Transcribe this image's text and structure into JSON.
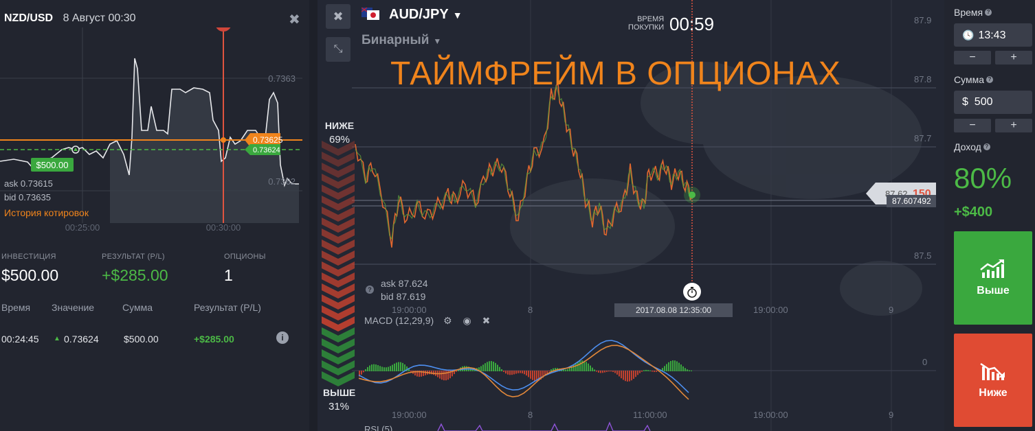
{
  "left_panel": {
    "pair": "NZD/USD",
    "date": "8 Август 00:30",
    "close_icon": "✖",
    "chart": {
      "price_levels": [
        "0.7363",
        "0.7362"
      ],
      "strike_label": "$500.00",
      "orange_tag": "0.73625",
      "green_tag": "0.73624",
      "ask": "ask 0.73615",
      "bid": "bid 0.73635",
      "history_link": "История котировок",
      "time_labels": [
        "00:25:00",
        "00:30:00"
      ]
    },
    "stats": [
      {
        "label": "ИНВЕСТИЦИЯ",
        "value": "$500.00",
        "color": "#ffffff"
      },
      {
        "label": "РЕЗУЛЬТАТ (P/L)",
        "value": "+$285.00",
        "color": "#4cba46"
      },
      {
        "label": "ОПЦИОНЫ",
        "value": "1",
        "color": "#ffffff"
      }
    ],
    "table": {
      "headers": [
        "Время",
        "Значение",
        "Сумма",
        "Результат (P/L)"
      ],
      "rows": [
        {
          "time": "00:24:45",
          "value": "0.73624",
          "amount": "$500.00",
          "result": "+$285.00"
        }
      ]
    }
  },
  "main_chart": {
    "asset": "AUD/JPY",
    "type": "Бинарный",
    "purchase_label_1": "ВРЕМЯ",
    "purchase_label_2": "ПОКУПКИ",
    "purchase_timer": "00:59",
    "overlay_title": "ТАЙМФРЕЙМ В ОПЦИОНАХ",
    "lower_label": "НИЖЕ",
    "lower_pct": "69%",
    "upper_label": "ВЫШЕ",
    "upper_pct": "31%",
    "ask": "ask 87.624",
    "bid": "bid 87.619",
    "price_levels": [
      "87.9",
      "87.8",
      "87.7",
      "87.5"
    ],
    "current_price": "87.62",
    "current_price_suffix": "150",
    "strike_price": "87.607492",
    "macd_label": "MACD (12,29,9)",
    "macd_zero": "0",
    "rsi_label": "RSI (5)",
    "expiry_datetime": "2017.08.08 12:35:00",
    "time_axis": [
      "19:00:00",
      "8",
      "19:00:00",
      "9"
    ],
    "time_axis_lower": [
      "19:00:00",
      "8",
      "11:00:00",
      "19:00:00",
      "9"
    ]
  },
  "right_panel": {
    "time_label": "Время",
    "time_value": "13:43",
    "amount_label": "Сумма",
    "amount_value": "$  500",
    "minus": "−",
    "plus": "+",
    "income_label": "Доход",
    "payout": "80%",
    "profit": "+$400",
    "call_label": "Выше",
    "put_label": "Ниже",
    "colors": {
      "call": "#3aa83e",
      "put": "#e04b33",
      "accent_green": "#4cba46",
      "accent_orange": "#f0841c"
    }
  }
}
